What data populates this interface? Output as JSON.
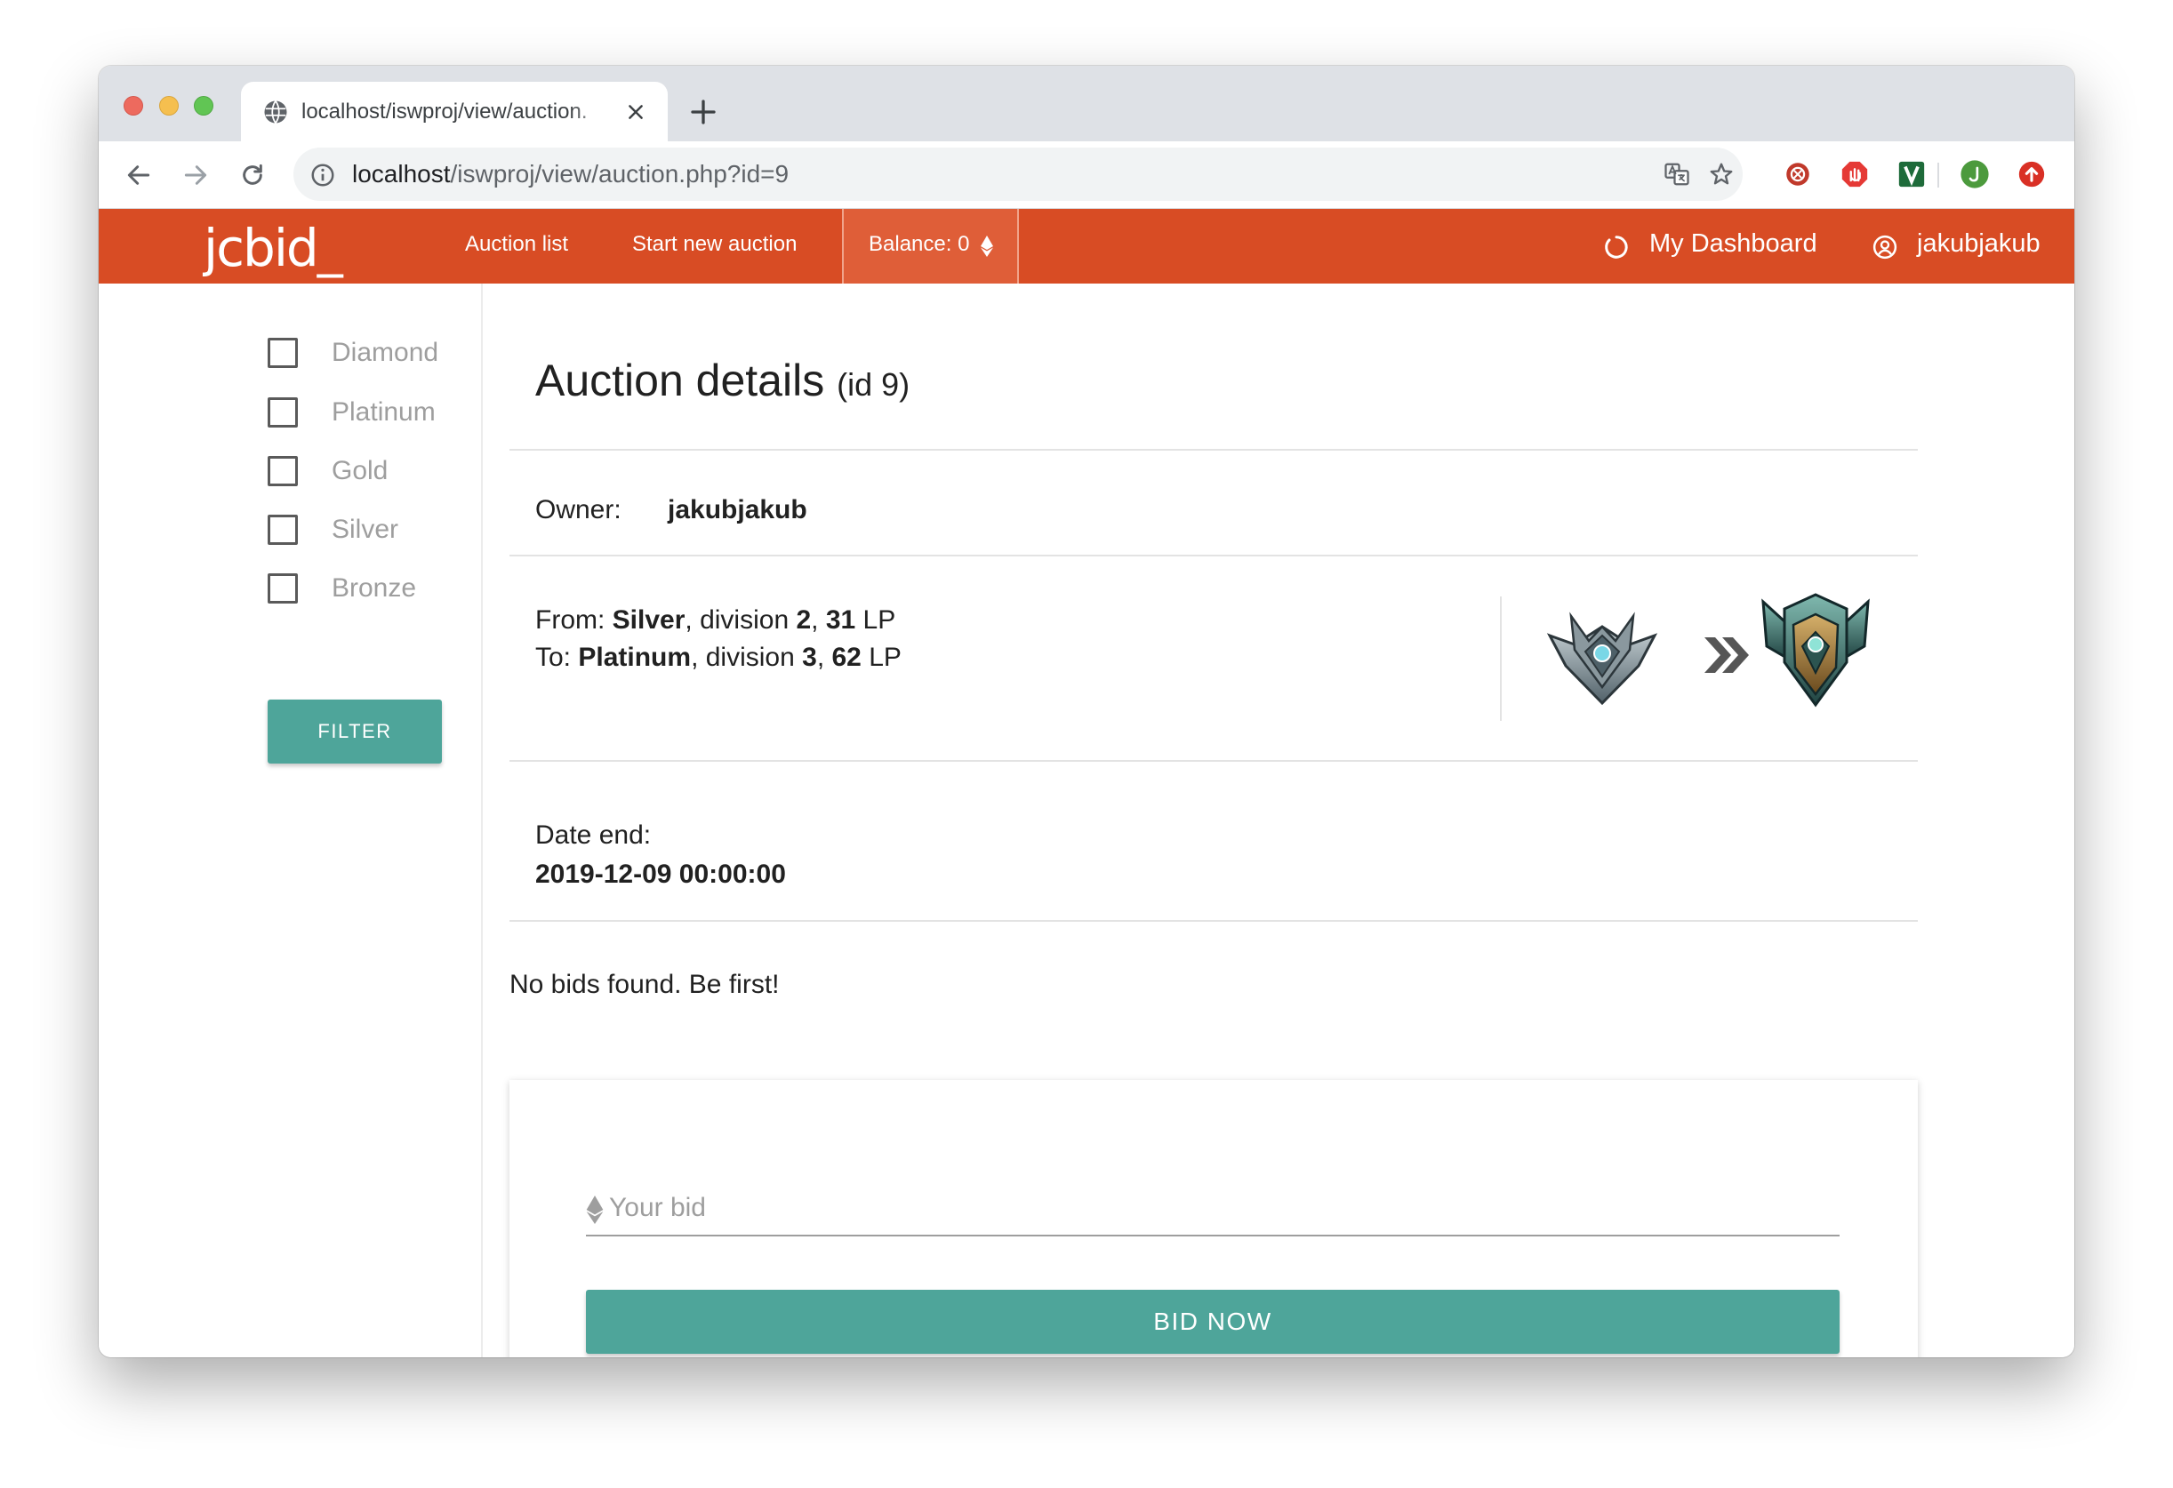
{
  "browser": {
    "tab_title": "localhost/iswproj/view/auction.",
    "url_host": "localhost",
    "url_path": "/iswproj/view/auction.php?id=9"
  },
  "navbar": {
    "brand": "jcbid_",
    "links": [
      "Auction list",
      "Start new auction"
    ],
    "balance_label": "Balance: 0",
    "dashboard_label": "My Dashboard",
    "username": "jakubjakub",
    "color": "#d84c24"
  },
  "sidebar": {
    "filters": [
      "Diamond",
      "Platinum",
      "Gold",
      "Silver",
      "Bronze"
    ],
    "filter_button": "FILTER"
  },
  "auction": {
    "title": "Auction details",
    "id_label": "(id 9)",
    "owner_label": "Owner:",
    "owner_value": "jakubjakub",
    "from_label": "From:",
    "from_tier": "Silver",
    "from_division_text": ", division",
    "from_division": "2",
    "from_lp": "31",
    "to_label": "To:",
    "to_tier": "Platinum",
    "to_division_text": ", division",
    "to_division": "3",
    "to_lp": "62",
    "lp_unit": "LP",
    "date_end_label": "Date end:",
    "date_end_value": "2019-12-09 00:00:00",
    "no_bids_text": "No bids found. Be first!"
  },
  "bid_form": {
    "placeholder": "Your bid",
    "button": "BID NOW",
    "accent": "#4ea59a"
  },
  "icons": [
    "globe-icon",
    "close-icon",
    "plus-icon",
    "back-icon",
    "forward-icon",
    "reload-icon",
    "info-icon",
    "translate-icon",
    "star-icon",
    "ethereum-icon",
    "spinner-icon",
    "account-circle-icon",
    "double-chevron-right-icon",
    "silver-emblem-icon",
    "platinum-emblem-icon"
  ]
}
